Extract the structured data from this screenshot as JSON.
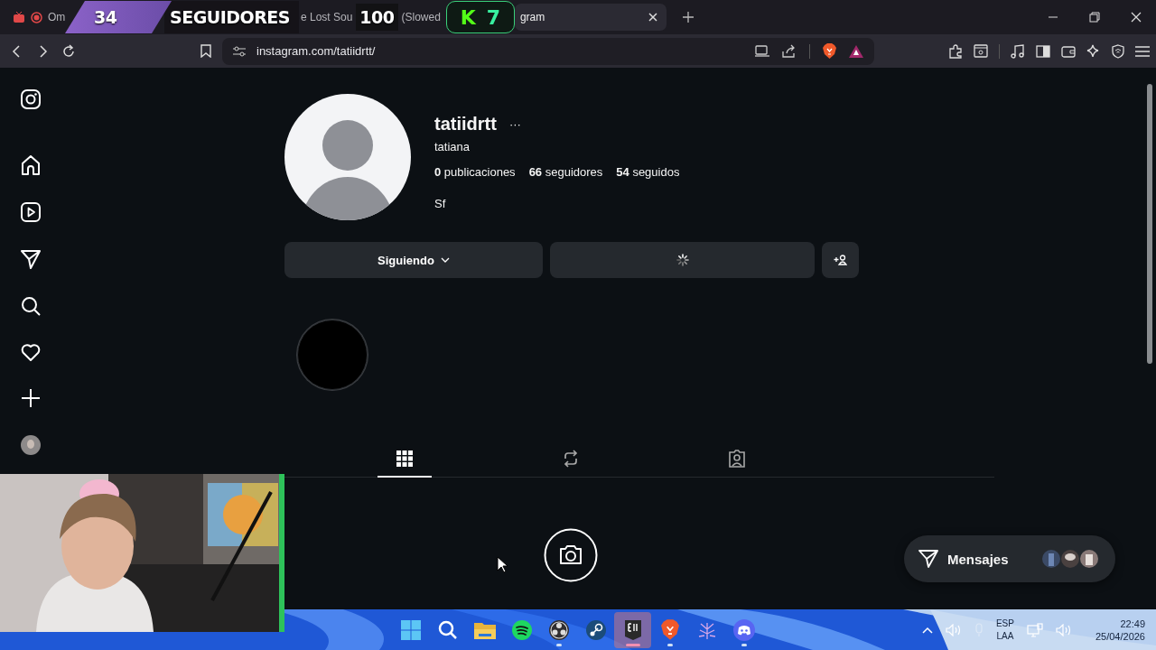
{
  "stream_overlay": {
    "follower_count": "34",
    "label": "SEGUIDORES",
    "goal": "100",
    "badge_letter": "K",
    "badge_count": "7"
  },
  "browser": {
    "tabs": [
      {
        "media_icons": true,
        "parts": [
          "Om"
        ],
        "selected": false
      },
      {
        "parts": [
          "e Lost Sou",
          "(Slowed"
        ],
        "selected": false
      },
      {
        "parts": [
          "gram"
        ],
        "selected": true
      }
    ],
    "url": "instagram.com/tatiidrtt/"
  },
  "sidebar": {
    "items": [
      {
        "kind": "logo"
      },
      {
        "kind": "home"
      },
      {
        "kind": "reels"
      },
      {
        "kind": "send"
      },
      {
        "kind": "search"
      },
      {
        "kind": "heart"
      },
      {
        "kind": "create"
      },
      {
        "kind": "avatar"
      }
    ]
  },
  "profile": {
    "username": "tatiidrtt",
    "more": "···",
    "name": "tatiana",
    "stats": [
      {
        "count": "0",
        "label": "publicaciones"
      },
      {
        "count": "66",
        "label": "seguidores"
      },
      {
        "count": "54",
        "label": "seguidos"
      }
    ],
    "bio": "Sf",
    "follow_button": "Siguiendo"
  },
  "profile_tabs": [
    {
      "kind": "grid",
      "selected": true
    },
    {
      "kind": "reposts",
      "selected": false
    },
    {
      "kind": "tagged",
      "selected": false
    }
  ],
  "messages_button": {
    "label": "Mensajes"
  },
  "taskbar": {
    "apps": [
      {
        "kind": "start",
        "selected": false,
        "running": false
      },
      {
        "kind": "search",
        "selected": false,
        "running": false
      },
      {
        "kind": "folder",
        "selected": false,
        "running": false
      },
      {
        "kind": "spotify",
        "selected": false,
        "running": false
      },
      {
        "kind": "obs",
        "selected": false,
        "running": true
      },
      {
        "kind": "steam",
        "selected": false,
        "running": false
      },
      {
        "kind": "epic",
        "selected": true,
        "running": true
      },
      {
        "kind": "brave",
        "selected": false,
        "running": true
      },
      {
        "kind": "tree",
        "selected": false,
        "running": false
      },
      {
        "kind": "discord",
        "selected": false,
        "running": true
      }
    ],
    "language": [
      "ESP",
      "LAA"
    ],
    "time": "22:49",
    "date": "25/04/2026"
  }
}
